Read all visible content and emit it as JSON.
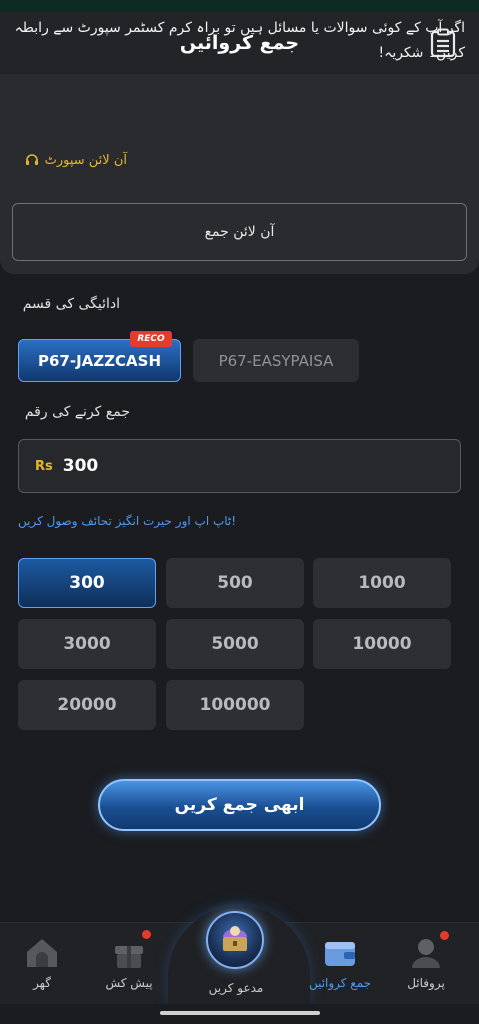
{
  "header": {
    "title": "جمع کروائیں",
    "menu_icon": "clipboard-list-icon"
  },
  "notice": {
    "text": "اگر آپ کے کوئی سوالات یا مسائل ہیں تو براہ کرم کسٹمر سپورٹ سے رابطہ کریں۔ شکریہ!",
    "support_link": "آن لائن سپورٹ",
    "support_icon": "headset-icon"
  },
  "online_deposit": {
    "label": "آن لائن جمع"
  },
  "payment": {
    "label": "ادائیگی کی قسم",
    "methods": [
      {
        "label": "P67-JAZZCASH",
        "selected": true,
        "badge": "RECO"
      },
      {
        "label": "P67-EASYPAISA",
        "selected": false
      }
    ]
  },
  "amount": {
    "label": "جمع کرنے کی رقم",
    "currency": "Rs",
    "value": "300",
    "hint": "!ٹاپ اپ اور حیرت انگیز تحائف وصول کریں"
  },
  "presets": [
    "300",
    "500",
    "1000",
    "3000",
    "5000",
    "10000",
    "20000",
    "100000"
  ],
  "presets_selected": "300",
  "submit": {
    "label": "ابھی جمع کریں"
  },
  "nav": {
    "home": "گھر",
    "offers": "پیش کش",
    "invite": "مدعو کریں",
    "deposit": "جمع کروائیں",
    "profile": "پروفائل",
    "active": "deposit"
  },
  "colors": {
    "accent_blue": "#4d9af0",
    "gold": "#e7b52c",
    "badge_red": "#e53b2c"
  }
}
